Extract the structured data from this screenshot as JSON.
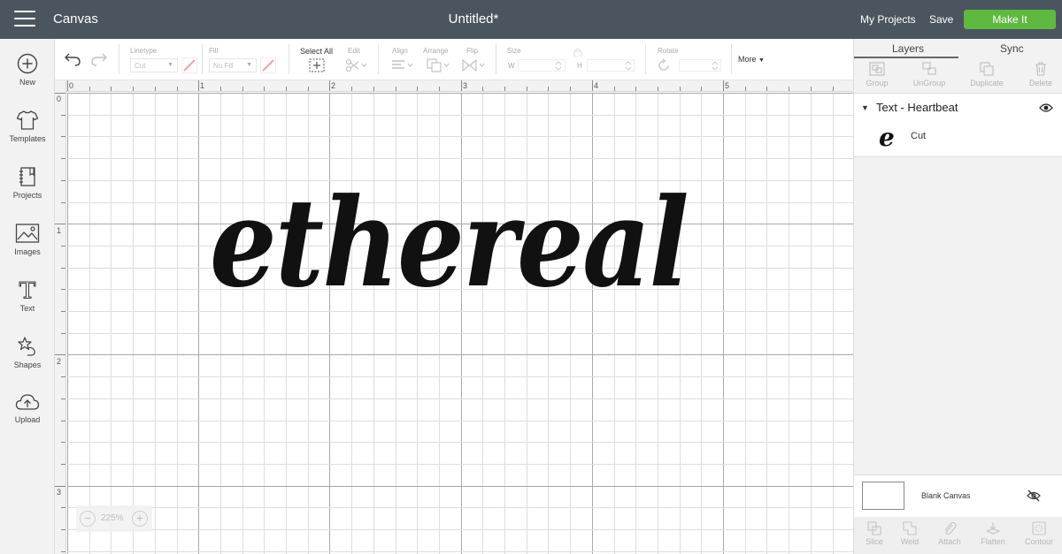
{
  "topbar": {
    "app_title": "Canvas",
    "doc_title": "Untitled*",
    "my_projects": "My Projects",
    "save": "Save",
    "make_it": "Make It",
    "make_it_color": "#5fb83f",
    "bar_color": "#4b5560"
  },
  "sidebar": {
    "items": [
      {
        "label": "New",
        "icon": "plus-circle-icon"
      },
      {
        "label": "Templates",
        "icon": "tshirt-icon"
      },
      {
        "label": "Projects",
        "icon": "notebook-icon"
      },
      {
        "label": "Images",
        "icon": "image-icon"
      },
      {
        "label": "Text",
        "icon": "text-t-icon"
      },
      {
        "label": "Shapes",
        "icon": "shapes-icon"
      },
      {
        "label": "Upload",
        "icon": "cloud-upload-icon"
      }
    ]
  },
  "toolbar": {
    "linetype_label": "Linetype",
    "linetype_value": "Cut",
    "fill_label": "Fill",
    "fill_value": "No Fill",
    "select_all": "Select All",
    "edit": "Edit",
    "align": "Align",
    "arrange": "Arrange",
    "flip": "Flip",
    "size": "Size",
    "width_label": "W",
    "height_label": "H",
    "rotate": "Rotate",
    "more": "More"
  },
  "canvas": {
    "ruler_top": [
      "0",
      "1",
      "2",
      "3",
      "4",
      "5"
    ],
    "ruler_left": [
      "0",
      "1",
      "2",
      "3"
    ],
    "text": "ethereal",
    "zoom": "225%"
  },
  "panel": {
    "tabs": [
      "Layers",
      "Sync"
    ],
    "actions": [
      "Group",
      "UnGroup",
      "Duplicate",
      "Delete"
    ],
    "layer_group": "Text - Heartbeat",
    "layer_thumb_glyph": "e",
    "layer_operation": "Cut",
    "blank_canvas": "Blank Canvas",
    "bottom_actions": [
      "Slice",
      "Weld",
      "Attach",
      "Flatten",
      "Contour"
    ]
  }
}
